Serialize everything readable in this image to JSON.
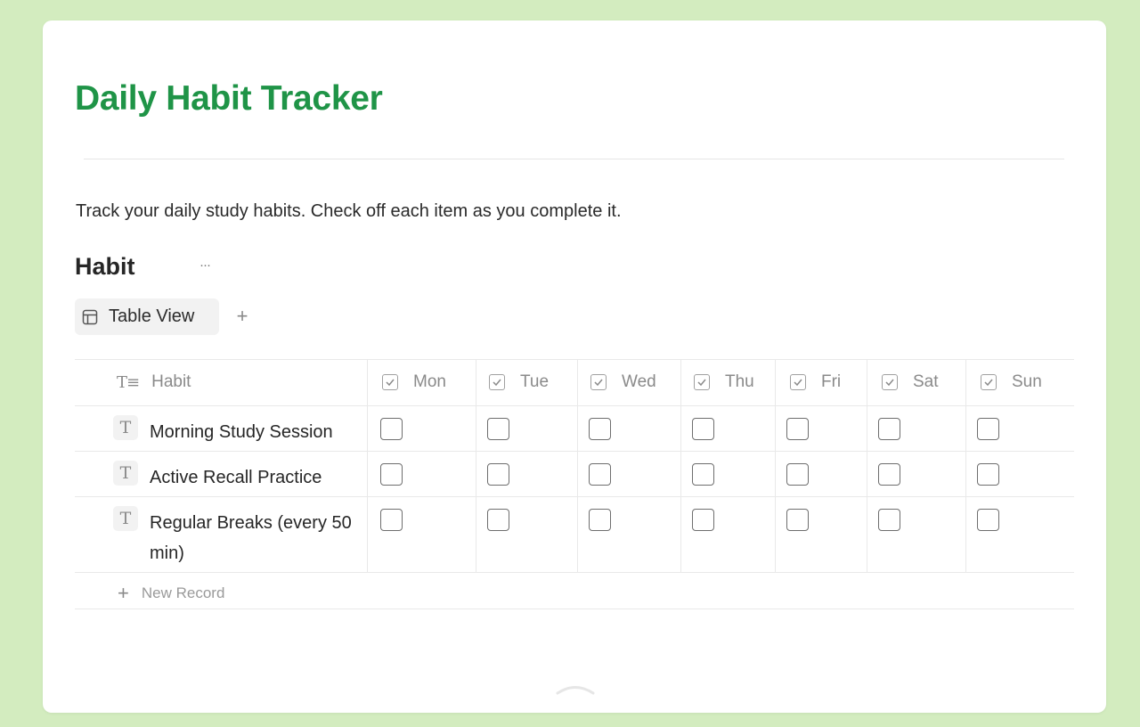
{
  "page": {
    "title": "Daily Habit Tracker",
    "description": "Track your daily study habits. Check off each item as you complete it."
  },
  "database": {
    "title": "Habit",
    "more_label": "···",
    "views": [
      {
        "label": "Table View",
        "icon": "table-icon"
      }
    ],
    "add_view_label": "+",
    "columns": [
      {
        "label": "Habit",
        "icon": "text-type-icon"
      },
      {
        "label": "Mon",
        "icon": "checkbox-icon"
      },
      {
        "label": "Tue",
        "icon": "checkbox-icon"
      },
      {
        "label": "Wed",
        "icon": "checkbox-icon"
      },
      {
        "label": "Thu",
        "icon": "checkbox-icon"
      },
      {
        "label": "Fri",
        "icon": "checkbox-icon"
      },
      {
        "label": "Sat",
        "icon": "checkbox-icon"
      },
      {
        "label": "Sun",
        "icon": "checkbox-icon"
      }
    ],
    "rows": [
      {
        "habit": "Morning Study Session",
        "checks": [
          false,
          false,
          false,
          false,
          false,
          false,
          false
        ]
      },
      {
        "habit": "Active Recall Practice",
        "checks": [
          false,
          false,
          false,
          false,
          false,
          false,
          false
        ]
      },
      {
        "habit": "Regular Breaks (every 50 min)",
        "checks": [
          false,
          false,
          false,
          false,
          false,
          false,
          false
        ]
      }
    ],
    "new_record_label": "New Record"
  },
  "colors": {
    "background": "#d3ecbf",
    "title": "#1f9447",
    "card": "#ffffff"
  }
}
